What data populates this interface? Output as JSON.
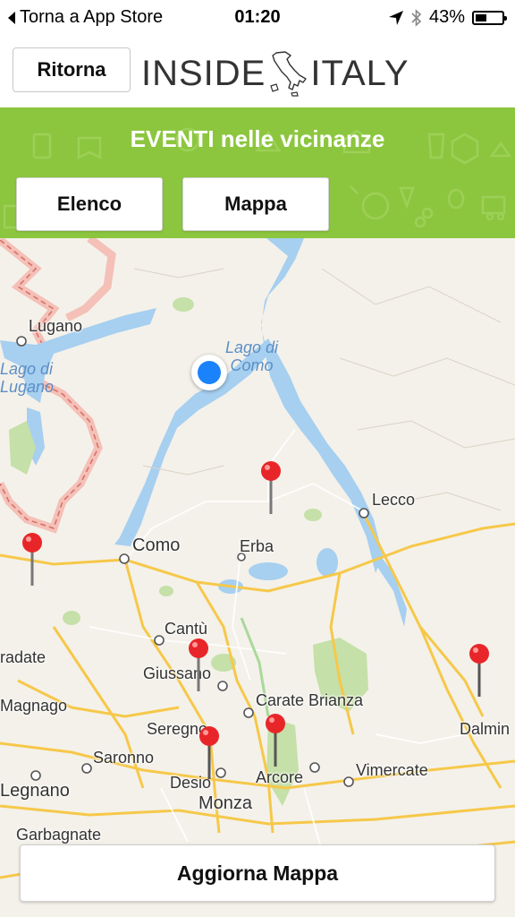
{
  "status_bar": {
    "back_app_label": "Torna a App Store",
    "time": "01:20",
    "battery_percent": "43%",
    "battery_level": 0.43
  },
  "header": {
    "back_label": "Ritorna",
    "logo_text_left": "INSIDE",
    "logo_text_right": "ITALY"
  },
  "banner": {
    "title": "EVENTI nelle vicinanze",
    "tabs": [
      {
        "label": "Elenco"
      },
      {
        "label": "Mappa"
      }
    ],
    "color": "#8cc63f"
  },
  "map": {
    "places": {
      "lugano": "Lugano",
      "lago_lugano_1": "Lago di",
      "lago_lugano_2": "Lugano",
      "lago_como_1": "Lago di",
      "lago_como_2": "Como",
      "como": "Como",
      "erba": "Erba",
      "lecco": "Lecco",
      "cantu": "Cantù",
      "giussano": "Giussano",
      "radate": "radate",
      "magnago": "Magnago",
      "carate": "Carate Brianza",
      "seregno": "Seregno",
      "saronno": "Saronno",
      "desio": "Desio",
      "arcore": "Arcore",
      "vimercate": "Vimercate",
      "legnano": "Legnano",
      "monza": "Monza",
      "garbagnate": "Garbagnate",
      "dalmine": "Dalmin"
    },
    "water_color": "#a6cff0",
    "pin_color": "#e8262a",
    "user_location_color": "#1a82fb"
  },
  "footer": {
    "refresh_label": "Aggiorna Mappa"
  }
}
